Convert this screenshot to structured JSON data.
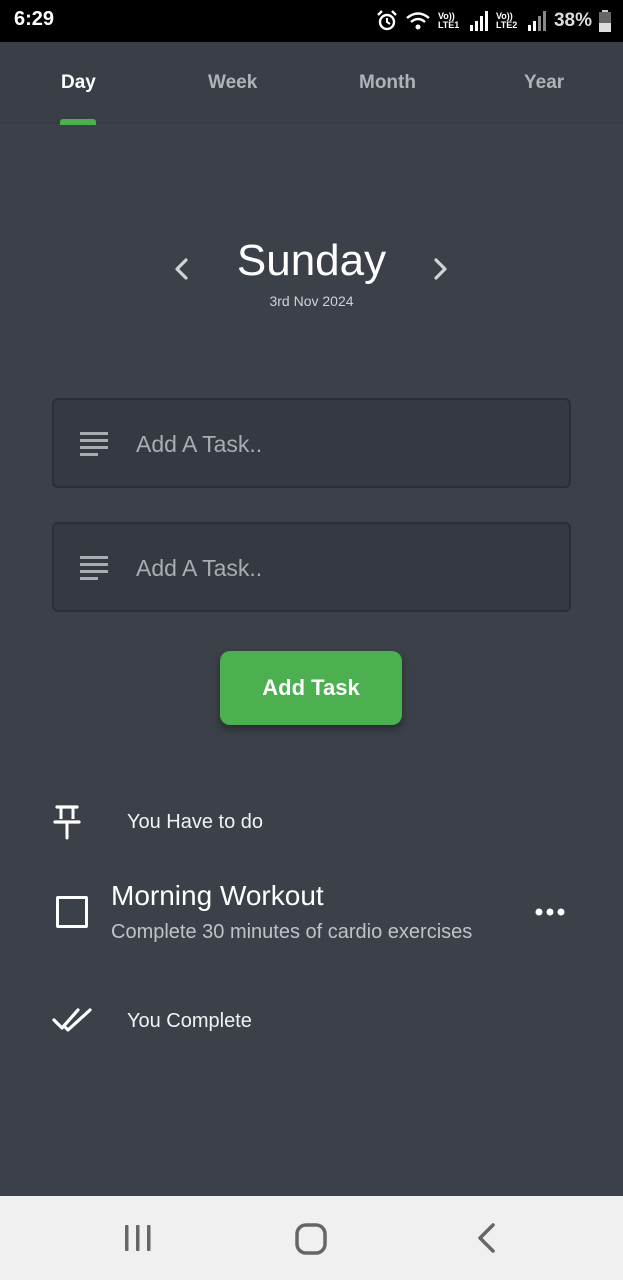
{
  "status_bar": {
    "time": "6:29",
    "network1": "Vo)) LTE1",
    "network2": "Vo)) LTE2",
    "battery": "38%",
    "icons": [
      "alarm-icon",
      "wifi-icon",
      "signal-icon",
      "battery-icon"
    ]
  },
  "tabs": [
    {
      "label": "Day",
      "active": true
    },
    {
      "label": "Week",
      "active": false
    },
    {
      "label": "Month",
      "active": false
    },
    {
      "label": "Year",
      "active": false
    }
  ],
  "date_nav": {
    "day": "Sunday",
    "date": "3rd Nov 2024"
  },
  "inputs": [
    {
      "placeholder": "Add A Task..",
      "value": ""
    },
    {
      "placeholder": "Add A Task..",
      "value": ""
    }
  ],
  "add_button": "Add Task",
  "sections": {
    "todo_label": "You Have to do",
    "complete_label": "You Complete"
  },
  "tasks": [
    {
      "title": "Morning Workout",
      "description": "Complete 30 minutes of cardio exercises",
      "checked": false
    }
  ],
  "colors": {
    "accent": "#4caf50",
    "background": "#3b4049",
    "input_bg": "#353a42"
  }
}
